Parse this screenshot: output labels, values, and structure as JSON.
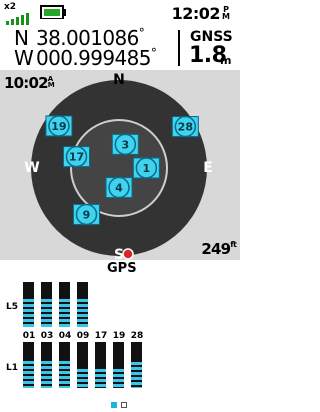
{
  "status": {
    "signal_multiplier": "x2",
    "time": "12:02",
    "ampm": "P\nM"
  },
  "position": {
    "lat_hemisphere": "N",
    "lat_value": "38.001086",
    "lon_hemisphere": "W",
    "lon_value": "000.999485",
    "degree_symbol": "°",
    "source_label": "GNSS",
    "accuracy_value": "1.8",
    "accuracy_unit": "m"
  },
  "skyview": {
    "clock_time": "10:02",
    "clock_ampm": "A\nM",
    "bearing_value": "249",
    "bearing_unit": "ft",
    "compass": {
      "n": "N",
      "e": "E",
      "s": "S",
      "w": "W"
    },
    "system_label": "GPS",
    "satellites": [
      {
        "prn": "19",
        "azimuth": 305,
        "elevation": 15
      },
      {
        "prn": "28",
        "azimuth": 58,
        "elevation": 10
      },
      {
        "prn": "3",
        "azimuth": 15,
        "elevation": 65
      },
      {
        "prn": "17",
        "azimuth": 285,
        "elevation": 45
      },
      {
        "prn": "1",
        "azimuth": 90,
        "elevation": 62
      },
      {
        "prn": "4",
        "azimuth": 180,
        "elevation": 70
      },
      {
        "prn": "9",
        "azimuth": 215,
        "elevation": 32
      }
    ],
    "colors": {
      "background": "#d8d8d8",
      "outer_ring": "#333333",
      "inner_ring": "#444444",
      "ring_line": "#cfcfcf",
      "satellite": "#3fd3f0",
      "satellite_border": "#0a6b86",
      "marker": "#d62828"
    }
  },
  "signal": {
    "l5_label": "L5",
    "l1_label": "L1",
    "l5_bars": [
      {
        "prn": "01",
        "strength": 1.0
      },
      {
        "prn": "03",
        "strength": 1.0
      },
      {
        "prn": "04",
        "strength": 1.0
      },
      {
        "prn": "09",
        "strength": 1.0
      }
    ],
    "l1_bars": [
      {
        "prn": "01",
        "strength": 0.95
      },
      {
        "prn": "03",
        "strength": 0.95
      },
      {
        "prn": "04",
        "strength": 0.95
      },
      {
        "prn": "09",
        "strength": 0.65
      },
      {
        "prn": "17",
        "strength": 0.65
      },
      {
        "prn": "19",
        "strength": 0.65
      },
      {
        "prn": "28",
        "strength": 0.9
      }
    ],
    "bar_fill_color": "#39c6e8",
    "page_count": 2,
    "current_page": 1
  }
}
